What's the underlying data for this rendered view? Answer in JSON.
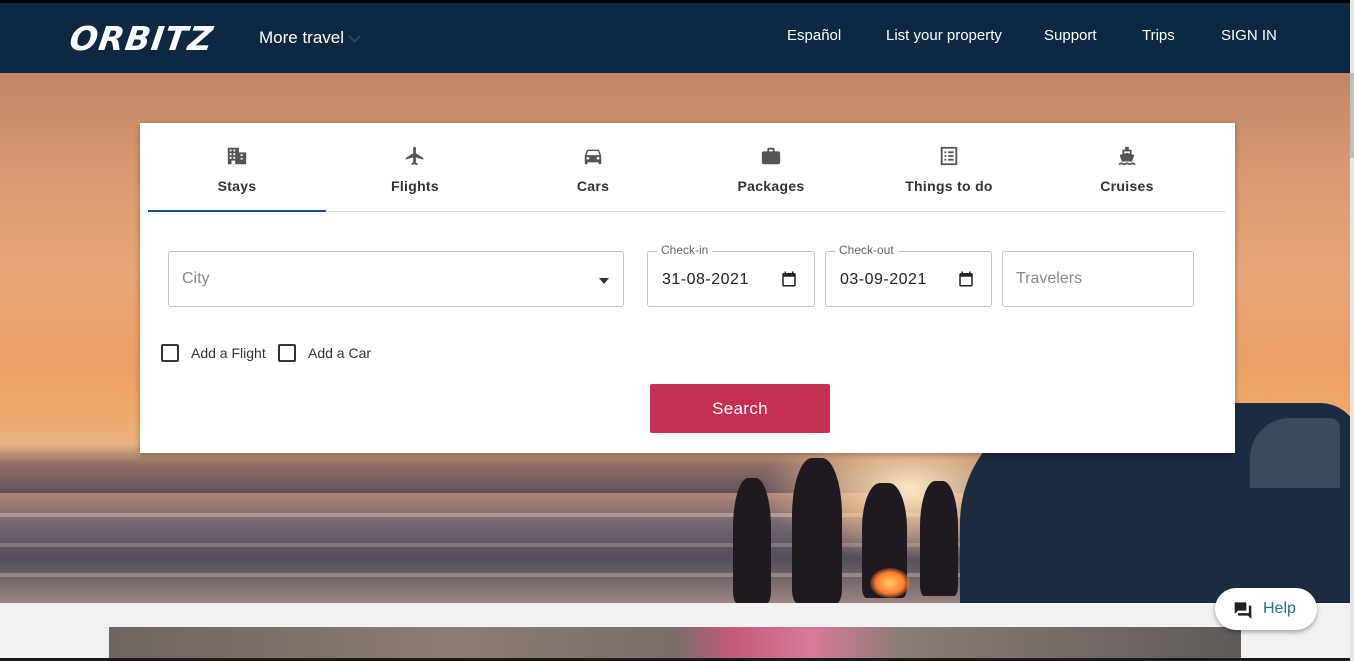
{
  "header": {
    "logo": "ORBITZ",
    "more_travel": "More travel",
    "nav": {
      "espanol": "Español",
      "list_property": "List your property",
      "support": "Support",
      "trips": "Trips",
      "sign_in": "SIGN IN"
    }
  },
  "search": {
    "tabs": [
      {
        "label": "Stays",
        "icon": "building-icon",
        "active": true
      },
      {
        "label": "Flights",
        "icon": "airplane-icon",
        "active": false
      },
      {
        "label": "Cars",
        "icon": "car-icon",
        "active": false
      },
      {
        "label": "Packages",
        "icon": "briefcase-icon",
        "active": false
      },
      {
        "label": "Things to do",
        "icon": "list-icon",
        "active": false
      },
      {
        "label": "Cruises",
        "icon": "ship-icon",
        "active": false
      }
    ],
    "city": {
      "placeholder": "City",
      "value": ""
    },
    "checkin": {
      "label": "Check-in",
      "value": "31-08-2021"
    },
    "checkout": {
      "label": "Check-out",
      "value": "03-09-2021"
    },
    "travelers": {
      "placeholder": "Travelers",
      "value": ""
    },
    "add_flight": {
      "label": "Add a Flight",
      "checked": false
    },
    "add_car": {
      "label": "Add a Car",
      "checked": false
    },
    "button": "Search"
  },
  "help": {
    "label": "Help"
  },
  "colors": {
    "header_bg": "#0d2840",
    "accent": "#c52f54",
    "tab_active": "#1b4f8f",
    "help_text": "#1b7a86"
  }
}
